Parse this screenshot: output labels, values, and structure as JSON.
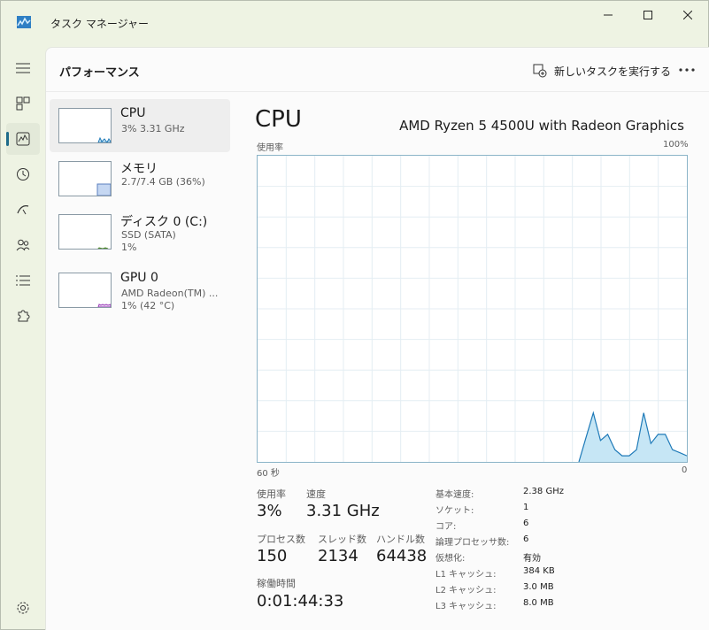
{
  "window": {
    "title": "タスク マネージャー"
  },
  "header": {
    "page_title": "パフォーマンス",
    "run_new_task": "新しいタスクを実行する"
  },
  "resources": [
    {
      "name": "CPU",
      "line1": "3%  3.31 GHz",
      "line2": "",
      "accent": "#1e7ab8",
      "fill": "#cde6f5"
    },
    {
      "name": "メモリ",
      "line1": "2.7/7.4 GB (36%)",
      "line2": "",
      "accent": "#5a7fbf",
      "fill": "#c5d7f2"
    },
    {
      "name": "ディスク 0 (C:)",
      "line1": "SSD (SATA)",
      "line2": "1%",
      "accent": "#4f8a2b",
      "fill": "#d7ecc7"
    },
    {
      "name": "GPU 0",
      "line1": "AMD Radeon(TM) ...",
      "line2": "1%  (42 °C)",
      "accent": "#9b3fb8",
      "fill": "#e9d2f2"
    }
  ],
  "detail": {
    "title": "CPU",
    "processor": "AMD Ryzen 5 4500U with Radeon Graphics",
    "graph_label_usage": "使用率",
    "graph_label_max": "100%",
    "graph_label_time": "60 秒",
    "graph_label_min": "0",
    "graph_color": "#1e7ab8",
    "graph_fill": "#c6e6f5",
    "usage_label": "使用率",
    "usage_value": "3%",
    "speed_label": "速度",
    "speed_value": "3.31 GHz",
    "processes_label": "プロセス数",
    "processes_value": "150",
    "threads_label": "スレッド数",
    "threads_value": "2134",
    "handles_label": "ハンドル数",
    "handles_value": "64438",
    "uptime_label": "稼働時間",
    "uptime_value": "0:01:44:33"
  },
  "specs": [
    {
      "label": "基本速度:",
      "value": "2.38 GHz"
    },
    {
      "label": "ソケット:",
      "value": "1"
    },
    {
      "label": "コア:",
      "value": "6"
    },
    {
      "label": "論理プロセッサ数:",
      "value": "6"
    },
    {
      "label": "仮想化:",
      "value": "有効"
    },
    {
      "label": "L1 キャッシュ:",
      "value": "384 KB"
    },
    {
      "label": "L2 キャッシュ:",
      "value": "3.0 MB"
    },
    {
      "label": "L3 キャッシュ:",
      "value": "8.0 MB"
    }
  ],
  "chart_data": {
    "type": "area",
    "x": [
      60,
      58,
      56,
      54,
      52,
      50,
      48,
      46,
      44,
      42,
      40,
      38,
      36,
      34,
      32,
      30,
      28,
      26,
      24,
      22,
      20,
      18,
      16,
      14,
      12,
      10,
      8,
      6,
      4,
      2,
      0
    ],
    "values": [
      0,
      0,
      0,
      0,
      0,
      0,
      0,
      0,
      0,
      0,
      0,
      0,
      0,
      0,
      0,
      0,
      0,
      0,
      0,
      0,
      0,
      0,
      0,
      0,
      0,
      0,
      0,
      0,
      0,
      0,
      0
    ],
    "tail": [
      0,
      8,
      16,
      7,
      9,
      4,
      2,
      2,
      4,
      16,
      6,
      9,
      9,
      4,
      3,
      2
    ],
    "ylim": [
      0,
      100
    ],
    "xlabel": "60 秒",
    "ylabel": "使用率"
  }
}
